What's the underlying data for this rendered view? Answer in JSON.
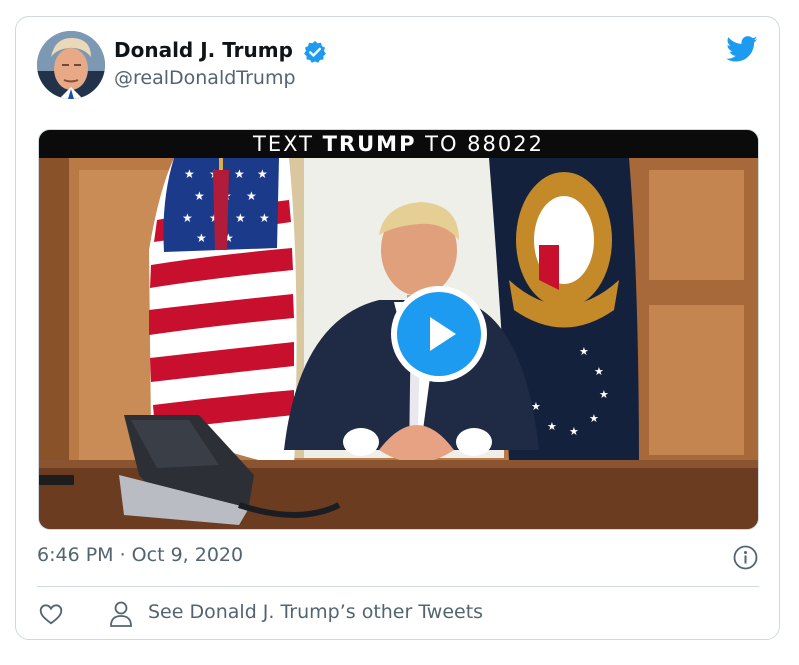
{
  "tweet": {
    "author_name": "Donald J. Trump",
    "author_handle": "@realDonaldTrump",
    "timestamp": "6:46 PM · Oct 9, 2020",
    "other_tweets_link": "See Donald J. Trump’s other Tweets"
  },
  "media": {
    "banner_prefix": "TEXT ",
    "banner_emphasis": "TRUMP",
    "banner_suffix": " TO 88022"
  },
  "icons": {
    "verified": "verified-badge-icon",
    "logo": "twitter-bird-icon",
    "play": "play-icon",
    "info": "info-icon",
    "like": "heart-icon",
    "profile": "person-icon"
  },
  "colors": {
    "accent": "#1d9bf0",
    "text_primary": "#0f1419",
    "text_secondary": "#536471",
    "border": "#cfd9de"
  }
}
